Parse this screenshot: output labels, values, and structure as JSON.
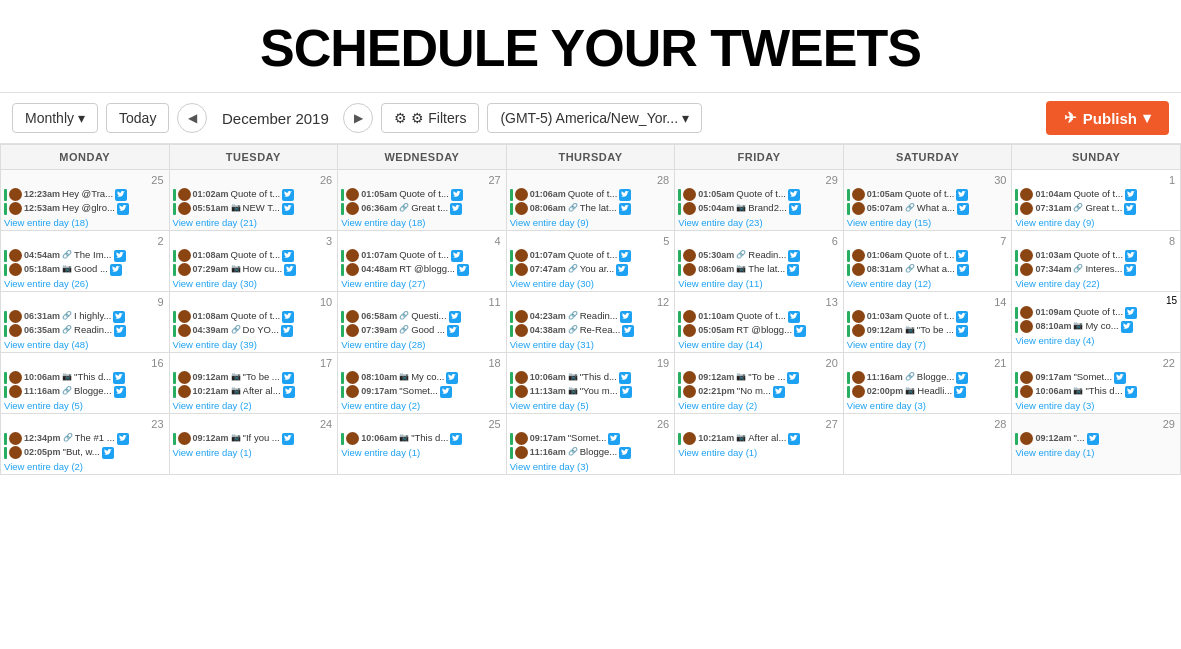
{
  "header": {
    "title": "SCHEDULE YOUR TWEETS"
  },
  "toolbar": {
    "monthly_label": "Monthly",
    "today_label": "Today",
    "prev_icon": "◀",
    "next_icon": "▶",
    "month_year": "December 2019",
    "filters_label": "⚙ Filters",
    "timezone_label": "(GMT-5) America/New_Yor...",
    "publish_label": "Publish"
  },
  "calendar": {
    "days": [
      "MONDAY",
      "TUESDAY",
      "WEDNESDAY",
      "THURSDAY",
      "FRIDAY",
      "SATURDAY",
      "SUNDAY"
    ],
    "weeks": [
      {
        "cells": [
          {
            "date": "25",
            "other": true,
            "tweets": [
              {
                "time": "12:23am",
                "icon": "",
                "text": "Hey @Tra..."
              },
              {
                "time": "12:53am",
                "icon": "",
                "text": "Hey @glro..."
              }
            ],
            "view": "View entire day (18)"
          },
          {
            "date": "26",
            "other": true,
            "tweets": [
              {
                "time": "01:02am",
                "icon": "",
                "text": "Quote of t..."
              },
              {
                "time": "05:51am",
                "icon": "📷",
                "text": "NEW T..."
              }
            ],
            "view": "View entire day (21)"
          },
          {
            "date": "27",
            "other": true,
            "tweets": [
              {
                "time": "01:05am",
                "icon": "",
                "text": "Quote of t..."
              },
              {
                "time": "06:36am",
                "icon": "🔗",
                "text": "Great t..."
              }
            ],
            "view": "View entire day (18)"
          },
          {
            "date": "28",
            "other": true,
            "tweets": [
              {
                "time": "01:06am",
                "icon": "",
                "text": "Quote of t..."
              },
              {
                "time": "08:06am",
                "icon": "🔗",
                "text": "The lat..."
              }
            ],
            "view": "View entire day (9)"
          },
          {
            "date": "29",
            "other": true,
            "tweets": [
              {
                "time": "01:05am",
                "icon": "",
                "text": "Quote of t..."
              },
              {
                "time": "05:04am",
                "icon": "📷",
                "text": "Brand2..."
              }
            ],
            "view": "View entire day (23)"
          },
          {
            "date": "30",
            "other": true,
            "tweets": [
              {
                "time": "01:05am",
                "icon": "",
                "text": "Quote of t..."
              },
              {
                "time": "05:07am",
                "icon": "🔗",
                "text": "What a..."
              }
            ],
            "view": "View entire day (15)"
          },
          {
            "date": "1",
            "tweets": [
              {
                "time": "01:04am",
                "icon": "",
                "text": "Quote of t..."
              },
              {
                "time": "07:31am",
                "icon": "🔗",
                "text": "Great t..."
              }
            ],
            "view": "View entire day (9)"
          }
        ]
      },
      {
        "cells": [
          {
            "date": "2",
            "tweets": [
              {
                "time": "04:54am",
                "icon": "🔗",
                "text": "The Im..."
              },
              {
                "time": "05:18am",
                "icon": "📷",
                "text": "Good ..."
              }
            ],
            "view": "View entire day (26)"
          },
          {
            "date": "3",
            "tweets": [
              {
                "time": "01:08am",
                "icon": "",
                "text": "Quote of t..."
              },
              {
                "time": "07:29am",
                "icon": "📷",
                "text": "How cu..."
              }
            ],
            "view": "View entire day (30)"
          },
          {
            "date": "4",
            "tweets": [
              {
                "time": "01:07am",
                "icon": "",
                "text": "Quote of t..."
              },
              {
                "time": "04:48am",
                "icon": "",
                "text": "RT @blogg..."
              }
            ],
            "view": "View entire day (27)"
          },
          {
            "date": "5",
            "tweets": [
              {
                "time": "01:07am",
                "icon": "",
                "text": "Quote of t..."
              },
              {
                "time": "07:47am",
                "icon": "🔗",
                "text": "You ar..."
              }
            ],
            "view": "View entire day (30)"
          },
          {
            "date": "6",
            "tweets": [
              {
                "time": "05:30am",
                "icon": "🔗",
                "text": "Readin..."
              },
              {
                "time": "08:06am",
                "icon": "📷",
                "text": "The lat..."
              }
            ],
            "view": "View entire day (11)"
          },
          {
            "date": "7",
            "tweets": [
              {
                "time": "01:06am",
                "icon": "",
                "text": "Quote of t..."
              },
              {
                "time": "08:31am",
                "icon": "🔗",
                "text": "What a..."
              }
            ],
            "view": "View entire day (12)"
          },
          {
            "date": "8",
            "tweets": [
              {
                "time": "01:03am",
                "icon": "",
                "text": "Quote of t..."
              },
              {
                "time": "07:34am",
                "icon": "🔗",
                "text": "Interes..."
              }
            ],
            "view": "View entire day (22)"
          }
        ]
      },
      {
        "cells": [
          {
            "date": "9",
            "tweets": [
              {
                "time": "06:31am",
                "icon": "🔗",
                "text": "I highly..."
              },
              {
                "time": "06:35am",
                "icon": "🔗",
                "text": "Readin..."
              }
            ],
            "view": "View entire day (48)"
          },
          {
            "date": "10",
            "tweets": [
              {
                "time": "01:08am",
                "icon": "",
                "text": "Quote of t..."
              },
              {
                "time": "04:39am",
                "icon": "🔗",
                "text": "Do YO..."
              }
            ],
            "view": "View entire day (39)"
          },
          {
            "date": "11",
            "tweets": [
              {
                "time": "06:58am",
                "icon": "🔗",
                "text": "Questi..."
              },
              {
                "time": "07:39am",
                "icon": "🔗",
                "text": "Good ..."
              }
            ],
            "view": "View entire day (28)"
          },
          {
            "date": "12",
            "tweets": [
              {
                "time": "04:23am",
                "icon": "🔗",
                "text": "Readin..."
              },
              {
                "time": "04:38am",
                "icon": "🔗",
                "text": "Re-Rea..."
              }
            ],
            "view": "View entire day (31)"
          },
          {
            "date": "13",
            "tweets": [
              {
                "time": "01:10am",
                "icon": "",
                "text": "Quote of t..."
              },
              {
                "time": "05:05am",
                "icon": "",
                "text": "RT @blogg..."
              }
            ],
            "view": "View entire day (14)"
          },
          {
            "date": "14",
            "tweets": [
              {
                "time": "01:03am",
                "icon": "",
                "text": "Quote of t..."
              },
              {
                "time": "09:12am",
                "icon": "📷",
                "text": "\"To be ..."
              }
            ],
            "view": "View entire day (7)"
          },
          {
            "date": "15",
            "today": true,
            "tweets": [
              {
                "time": "01:09am",
                "icon": "",
                "text": "Quote of t..."
              },
              {
                "time": "08:10am",
                "icon": "📷",
                "text": "My co..."
              }
            ],
            "view": "View entire day (4)"
          }
        ]
      },
      {
        "cells": [
          {
            "date": "16",
            "tweets": [
              {
                "time": "10:06am",
                "icon": "📷",
                "text": "\"This d..."
              },
              {
                "time": "11:16am",
                "icon": "🔗",
                "text": "Blogge..."
              }
            ],
            "view": "View entire day (5)"
          },
          {
            "date": "17",
            "tweets": [
              {
                "time": "09:12am",
                "icon": "📷",
                "text": "\"To be ..."
              },
              {
                "time": "10:21am",
                "icon": "📷",
                "text": "After al..."
              }
            ],
            "view": "View entire day (2)"
          },
          {
            "date": "18",
            "tweets": [
              {
                "time": "08:10am",
                "icon": "📷",
                "text": "My co..."
              },
              {
                "time": "09:17am",
                "icon": "",
                "text": "\"Somet..."
              }
            ],
            "view": "View entire day (2)"
          },
          {
            "date": "19",
            "tweets": [
              {
                "time": "10:06am",
                "icon": "📷",
                "text": "\"This d..."
              },
              {
                "time": "11:13am",
                "icon": "📷",
                "text": "\"You m..."
              }
            ],
            "view": "View entire day (5)"
          },
          {
            "date": "20",
            "tweets": [
              {
                "time": "09:12am",
                "icon": "📷",
                "text": "\"To be ..."
              },
              {
                "time": "02:21pm",
                "icon": "",
                "text": "\"No m..."
              }
            ],
            "view": "View entire day (2)"
          },
          {
            "date": "21",
            "tweets": [
              {
                "time": "11:16am",
                "icon": "🔗",
                "text": "Blogge..."
              },
              {
                "time": "02:00pm",
                "icon": "📷",
                "text": "Headli..."
              }
            ],
            "view": "View entire day (3)"
          },
          {
            "date": "22",
            "tweets": [
              {
                "time": "09:17am",
                "icon": "",
                "text": "\"Somet..."
              },
              {
                "time": "10:06am",
                "icon": "📷",
                "text": "\"This d..."
              }
            ],
            "view": "View entire day (3)"
          }
        ]
      },
      {
        "cells": [
          {
            "date": "23",
            "tweets": [
              {
                "time": "12:34pm",
                "icon": "🔗",
                "text": "The #1 ..."
              },
              {
                "time": "02:05pm",
                "icon": "",
                "text": "\"But, w..."
              }
            ],
            "view": "View entire day (2)"
          },
          {
            "date": "24",
            "tweets": [
              {
                "time": "09:12am",
                "icon": "📷",
                "text": "\"If you ..."
              }
            ],
            "view": "View entire day (1)"
          },
          {
            "date": "25",
            "tweets": [
              {
                "time": "10:06am",
                "icon": "📷",
                "text": "\"This d..."
              }
            ],
            "view": "View entire day (1)"
          },
          {
            "date": "26",
            "tweets": [
              {
                "time": "09:17am",
                "icon": "",
                "text": "\"Somet..."
              },
              {
                "time": "11:16am",
                "icon": "🔗",
                "text": "Blogge..."
              }
            ],
            "view": "View entire day (3)"
          },
          {
            "date": "27",
            "tweets": [
              {
                "time": "10:21am",
                "icon": "📷",
                "text": "After al..."
              }
            ],
            "view": "View entire day (1)"
          },
          {
            "date": "28",
            "other": false,
            "tweets": [],
            "view": ""
          },
          {
            "date": "29",
            "other": true,
            "tweets": [
              {
                "time": "09:12am",
                "icon": "",
                "text": "\"..."
              }
            ],
            "view": "View entire day (1)"
          }
        ]
      }
    ]
  }
}
